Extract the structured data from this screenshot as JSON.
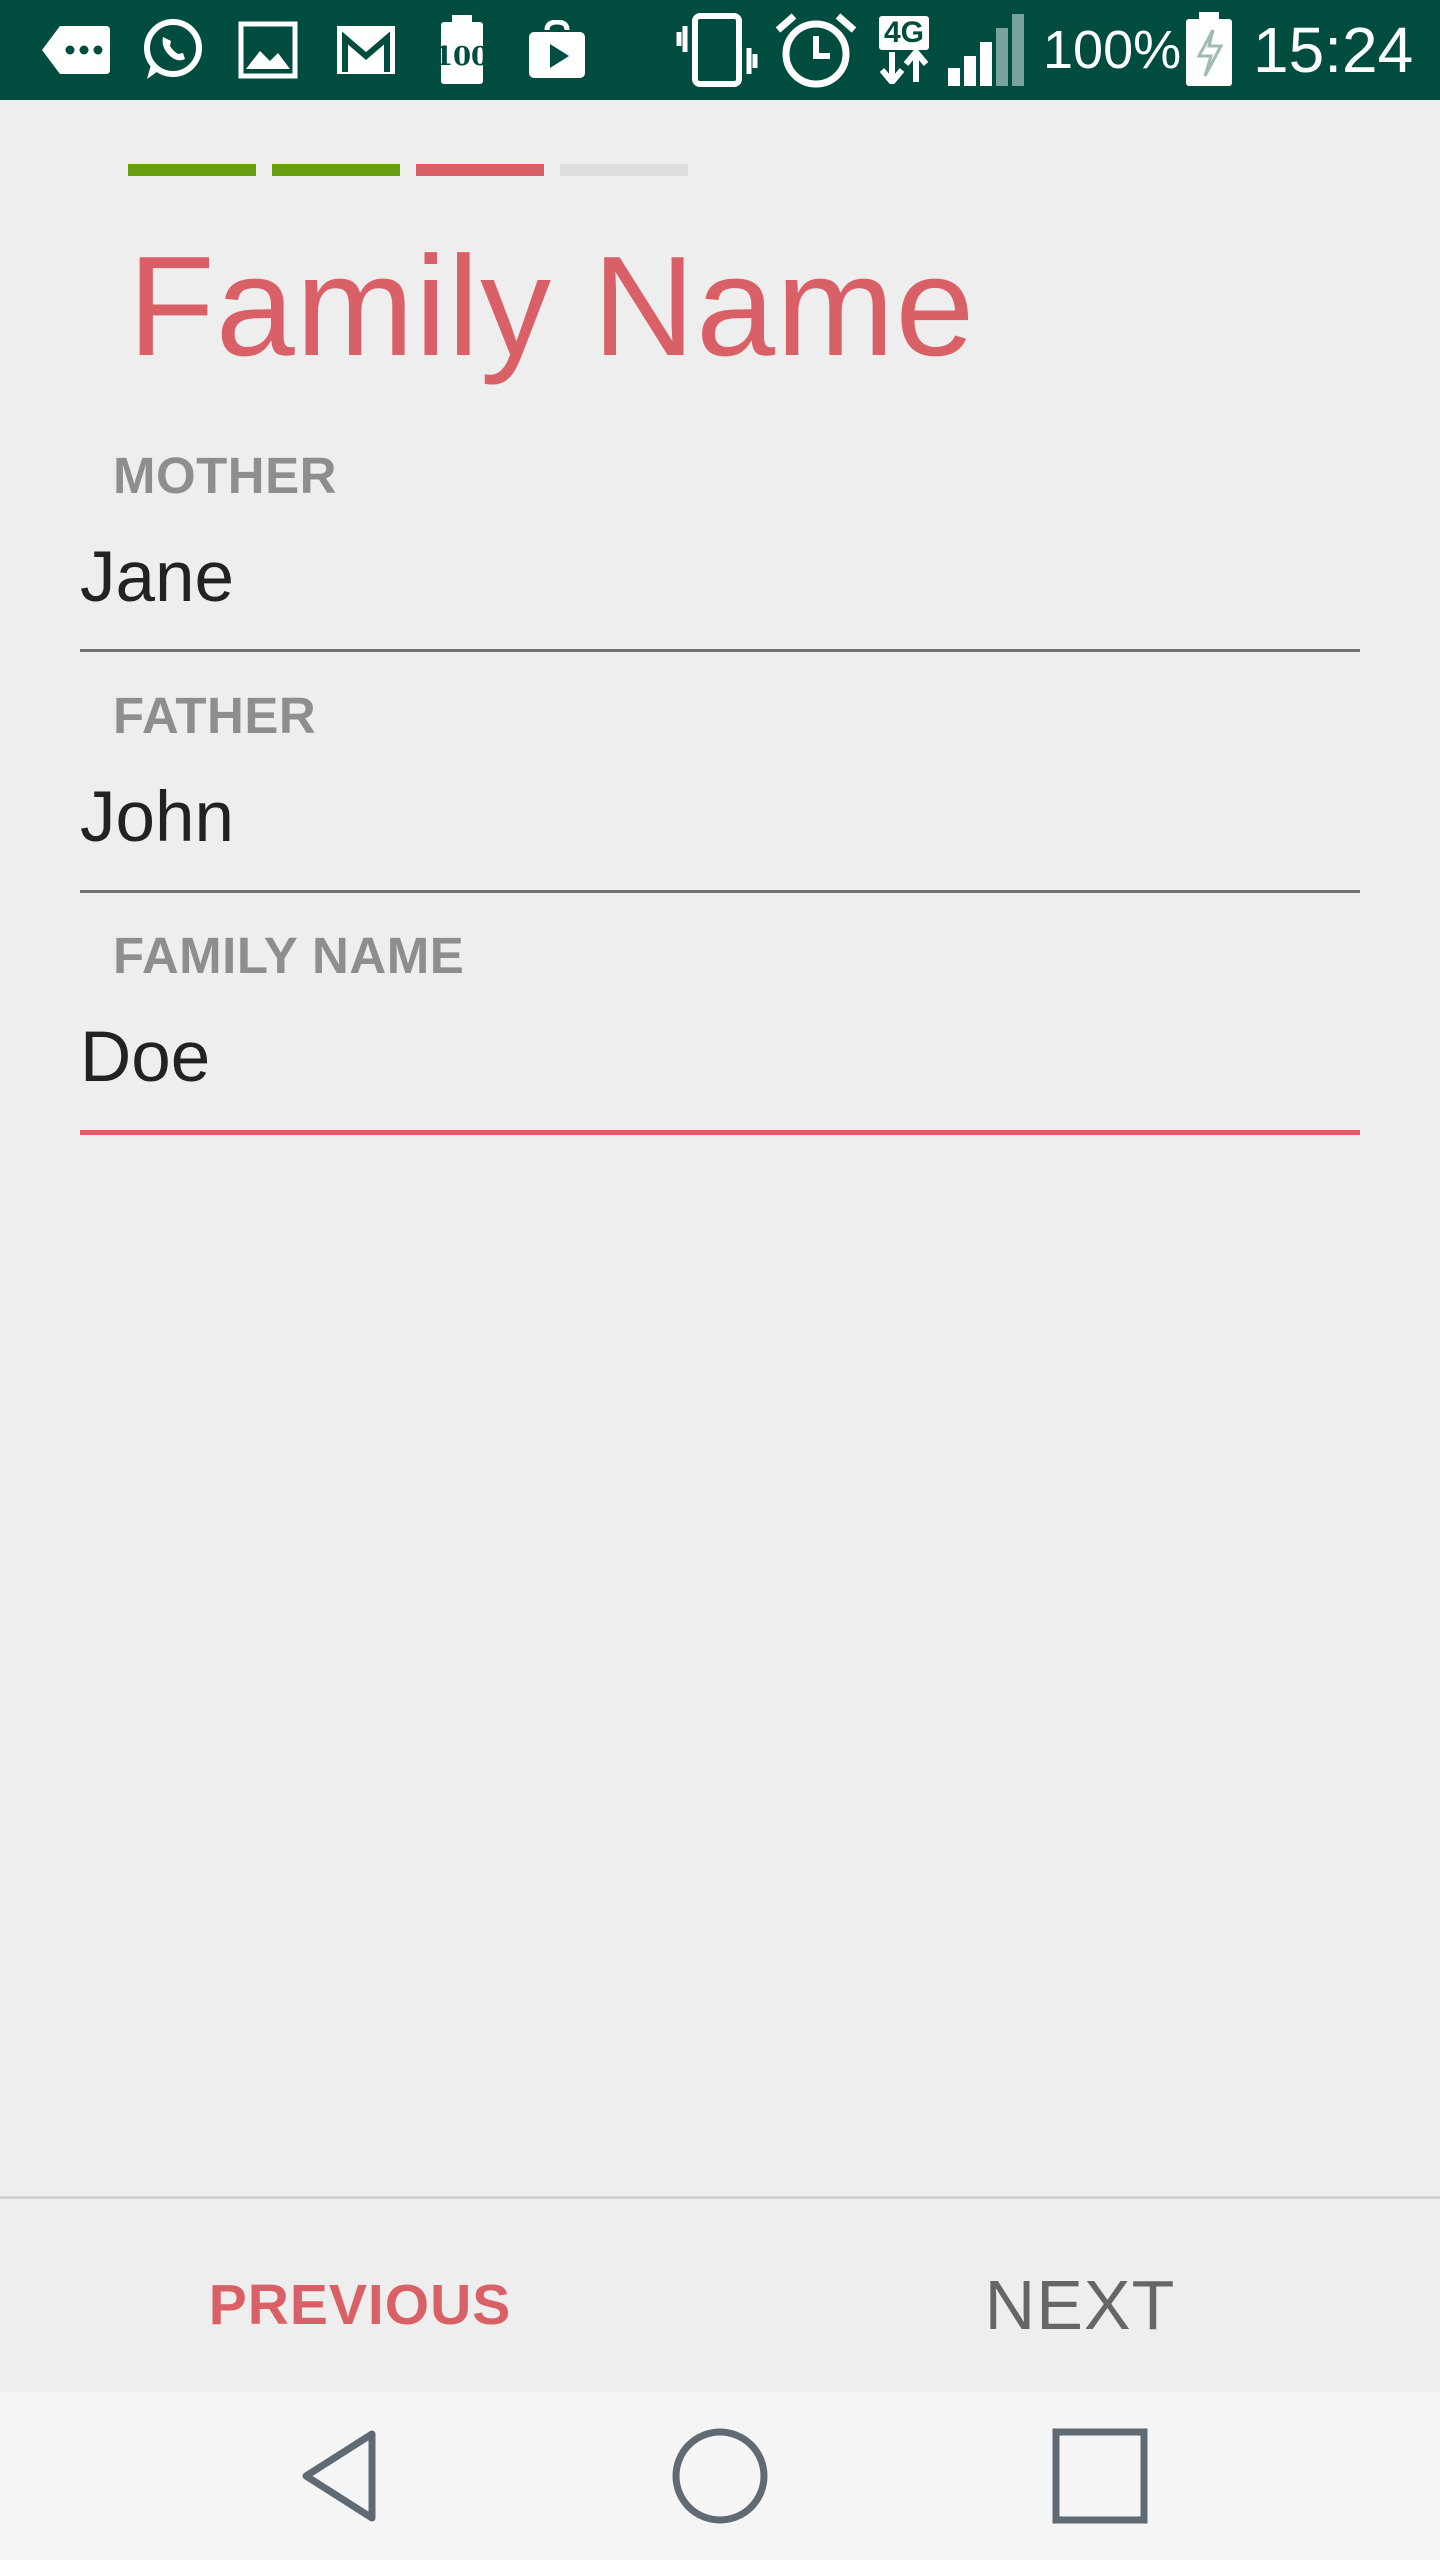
{
  "status_bar": {
    "battery_percent": "100%",
    "time": "15:24",
    "network": "4G",
    "notification_icon_badge": "100",
    "icons": [
      "more-icon",
      "whatsapp-icon",
      "gallery-icon",
      "gmail-icon",
      "battery-100-notif-icon",
      "play-store-icon",
      "vibrate-icon",
      "alarm-icon",
      "4g-data-icon",
      "signal-icon",
      "battery-charging-icon"
    ],
    "background": "#004d40"
  },
  "progress": {
    "steps": [
      {
        "state": "done",
        "color": "#6a9e11"
      },
      {
        "state": "done",
        "color": "#6a9e11"
      },
      {
        "state": "current",
        "color": "#d96066"
      },
      {
        "state": "todo",
        "color": "#dddddd"
      }
    ]
  },
  "title": "Family Name",
  "fields": [
    {
      "label": "MOTHER",
      "value": "Jane"
    },
    {
      "label": "FATHER",
      "value": "John"
    },
    {
      "label": "FAMILY NAME",
      "value": "Doe"
    }
  ],
  "buttons": {
    "previous": "PREVIOUS",
    "next": "NEXT"
  },
  "accent_color": "#d96066",
  "system_nav": [
    "back-icon",
    "home-icon",
    "recents-icon"
  ]
}
